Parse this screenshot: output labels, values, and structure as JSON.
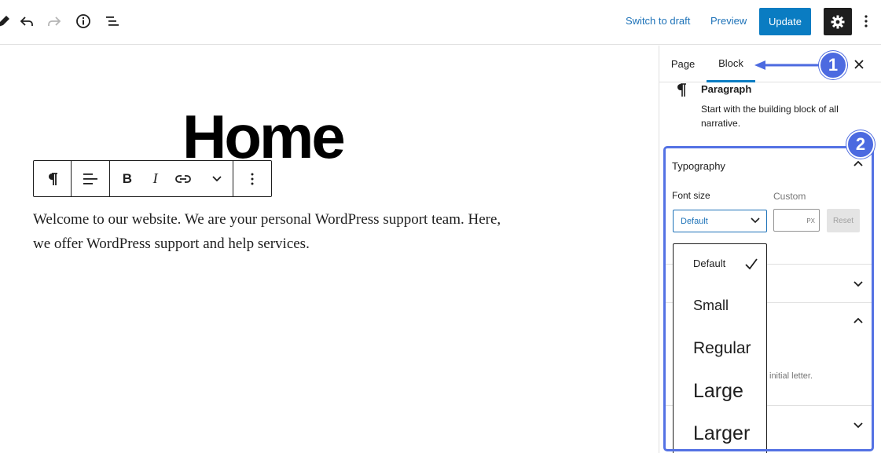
{
  "topbar": {
    "switch_to_draft": "Switch to draft",
    "preview": "Preview",
    "update": "Update",
    "icons": [
      "pencil-icon",
      "undo-icon",
      "redo-icon",
      "info-icon",
      "list-view-icon",
      "gear-icon",
      "more-vertical-icon"
    ]
  },
  "editor": {
    "title": "Home",
    "paragraph": "Welcome to our website. We are your personal WordPress support team. Here, we offer WordPress support and help services.",
    "toolbar_icons": [
      "paragraph-icon",
      "align-left-icon",
      "bold-icon",
      "italic-icon",
      "link-icon",
      "chevron-down-icon",
      "more-vertical-icon"
    ]
  },
  "sidebar": {
    "tabs": [
      {
        "label": "Page",
        "active": false
      },
      {
        "label": "Block",
        "active": true
      }
    ],
    "block": {
      "name": "Paragraph",
      "description": "Start with the building block of all narrative."
    },
    "typography": {
      "title": "Typography",
      "font_size_label": "Font size",
      "custom_label": "Custom",
      "selected": "Default",
      "unit": "PX",
      "reset": "Reset",
      "options": [
        "Default",
        "Small",
        "Regular",
        "Large",
        "Larger"
      ]
    },
    "drop_cap_help": "initial letter."
  },
  "annotations": {
    "callout_1": "1",
    "callout_2": "2"
  },
  "colors": {
    "accent": "#0a7cc2",
    "annotation": "#4c6ae0",
    "dark": "#1e1e1e"
  }
}
